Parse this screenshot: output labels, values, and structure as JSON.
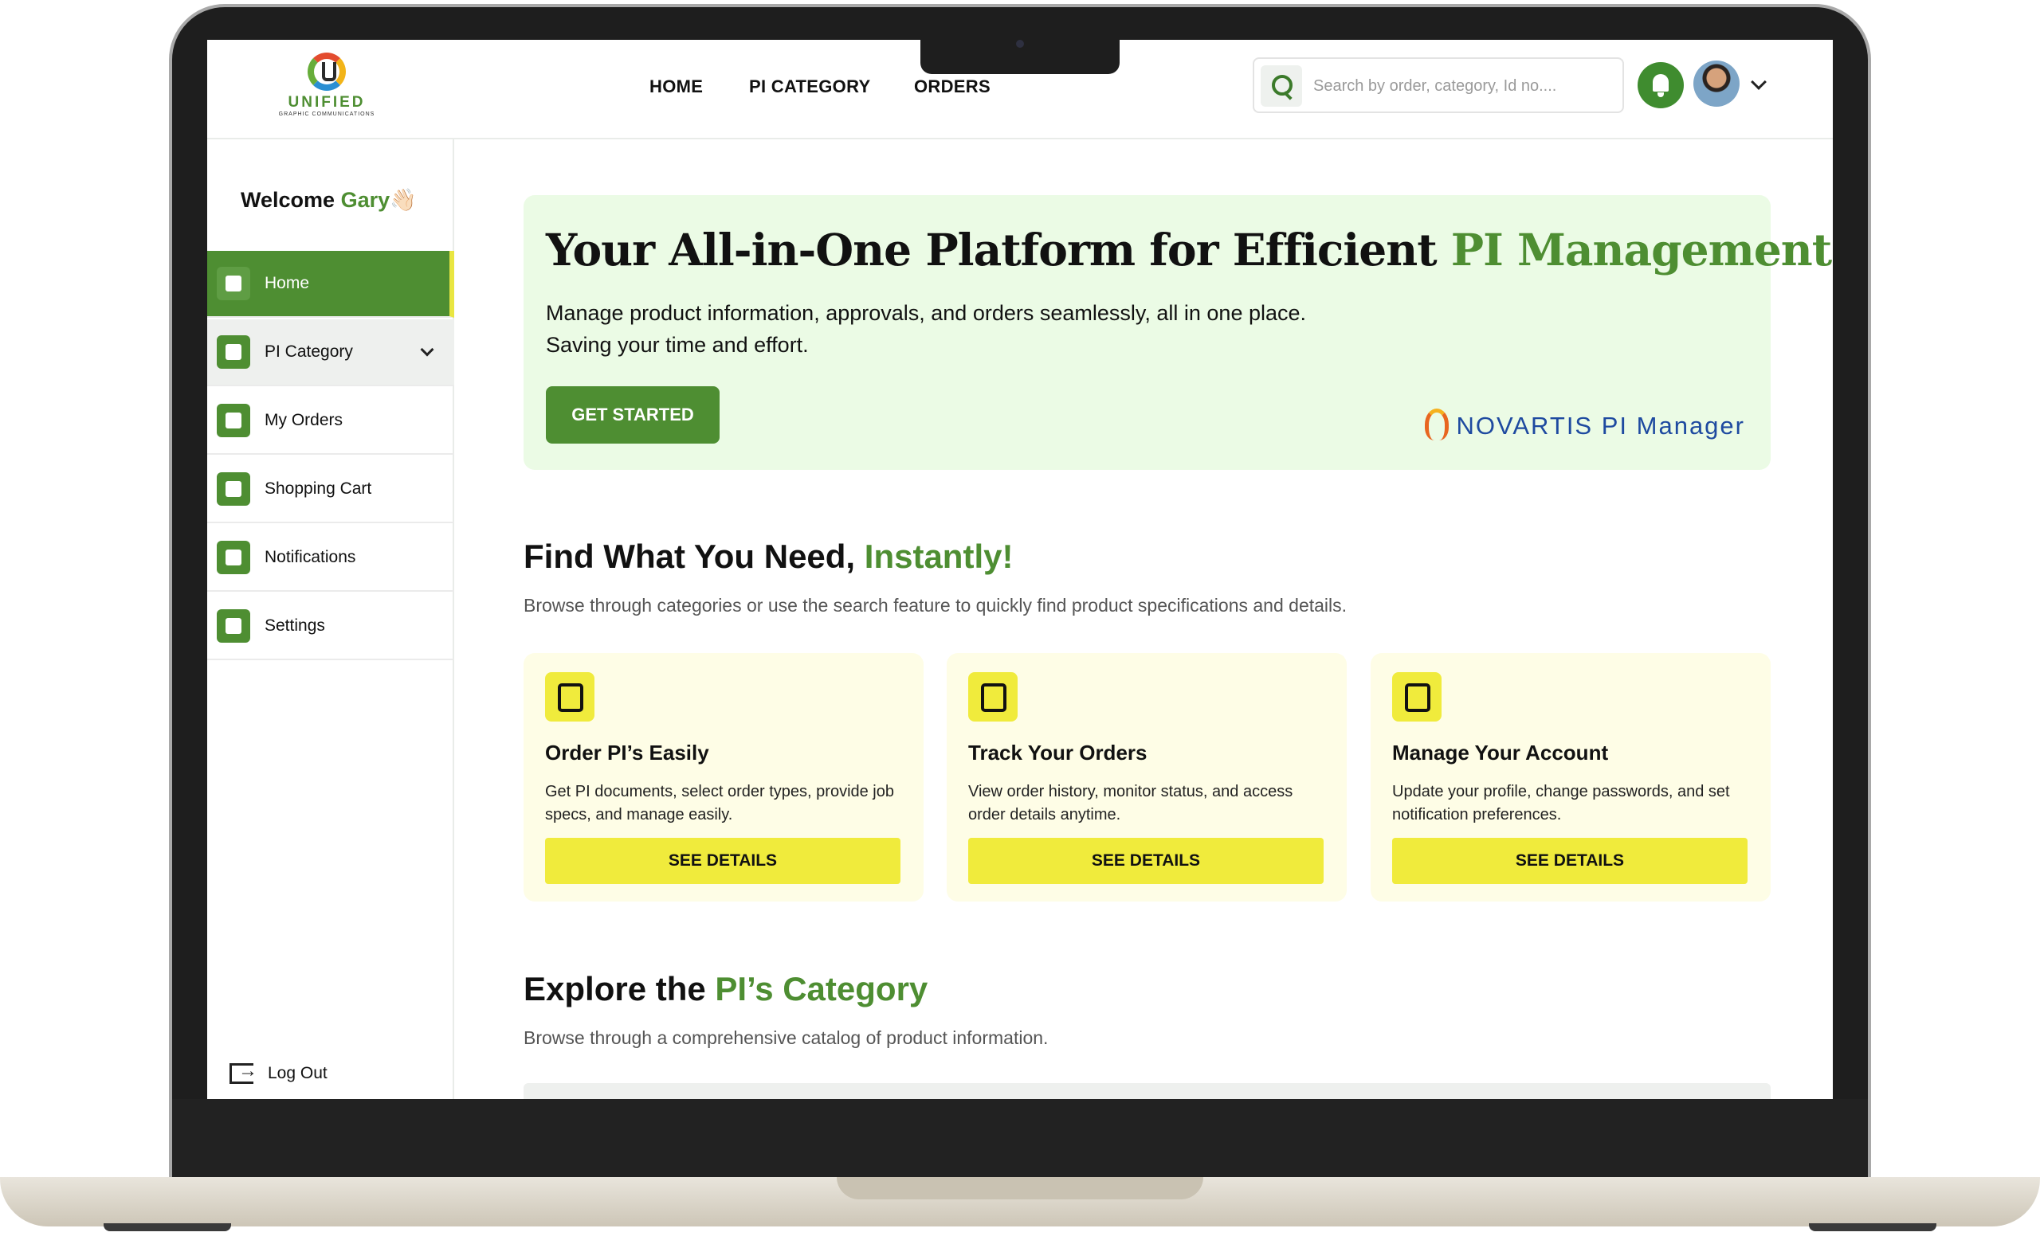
{
  "header": {
    "logo_name": "UNIFIED",
    "logo_sub": "GRAPHIC COMMUNICATIONS",
    "nav": [
      "HOME",
      "PI CATEGORY",
      "ORDERS"
    ],
    "search_placeholder": "Search by order, category, Id no...."
  },
  "sidebar": {
    "welcome_prefix": "Welcome ",
    "welcome_name": "Gary",
    "welcome_emoji": "👋🏻",
    "items": [
      {
        "label": "Home",
        "icon": "home-icon"
      },
      {
        "label": "PI Category",
        "icon": "user-circle-icon"
      },
      {
        "label": "My Orders",
        "icon": "layers-icon"
      },
      {
        "label": "Shopping Cart",
        "icon": "cart-icon"
      },
      {
        "label": "Notifications",
        "icon": "bell-icon"
      },
      {
        "label": "Settings",
        "icon": "gear-icon"
      }
    ],
    "logout": "Log Out"
  },
  "hero": {
    "title_main": "Your All-in-One Platform for Efficient ",
    "title_accent": "PI Management",
    "description": "Manage product information, approvals, and orders seamlessly, all in one place. Saving your time and effort.",
    "button": "GET STARTED",
    "brand": "NOVARTIS",
    "brand_product": "PI Manager"
  },
  "find": {
    "title_main": "Find What You Need, ",
    "title_accent": "Instantly!",
    "description": "Browse through categories or use the search feature to quickly find product specifications and details."
  },
  "cards": [
    {
      "title": "Order PI’s Easily",
      "description": "Get PI documents, select order types, provide job specs, and manage easily.",
      "button": "SEE DETAILS",
      "icon": "clipboard-icon"
    },
    {
      "title": "Track Your Orders",
      "description": "View order history, monitor status, and access order details anytime.",
      "button": "SEE DETAILS",
      "icon": "target-icon"
    },
    {
      "title": "Manage Your Account",
      "description": "Update your profile, change passwords, and set notification preferences.",
      "button": "SEE DETAILS",
      "icon": "settings-icon"
    }
  ],
  "explore": {
    "title_main": "Explore the ",
    "title_accent": "PI’s Category",
    "description": "Browse through a comprehensive catalog of product information."
  },
  "colors": {
    "brand_green": "#4e8e32",
    "accent_yellow": "#f0eb3c",
    "hero_bg": "#ebfbe5",
    "card_bg": "#fefde6"
  }
}
